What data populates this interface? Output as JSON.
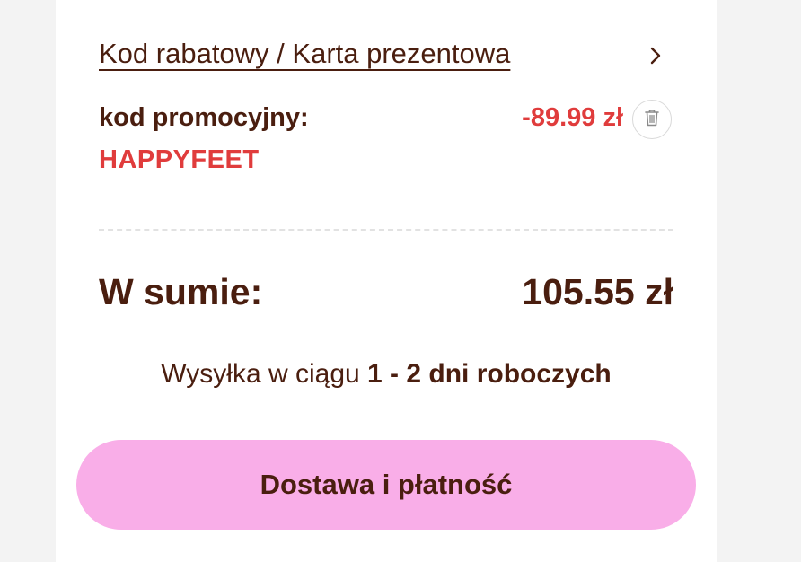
{
  "discount": {
    "link_label": "Kod rabatowy / Karta prezentowa"
  },
  "promo": {
    "label": "kod promocyjny:",
    "code": "HAPPYFEET",
    "amount": "-89.99 zł"
  },
  "total": {
    "label": "W sumie:",
    "value": "105.55 zł"
  },
  "shipping": {
    "prefix": "Wysyłka w ciągu ",
    "highlight": "1 - 2 dni roboczych"
  },
  "cta": {
    "label": "Dostawa i płatność"
  },
  "colors": {
    "text": "#4a1e0f",
    "discount_red": "#e03c3c",
    "cta_pink": "#f9aee8"
  },
  "icons": {
    "chevron": "chevron-right-icon",
    "delete": "trash-icon"
  }
}
